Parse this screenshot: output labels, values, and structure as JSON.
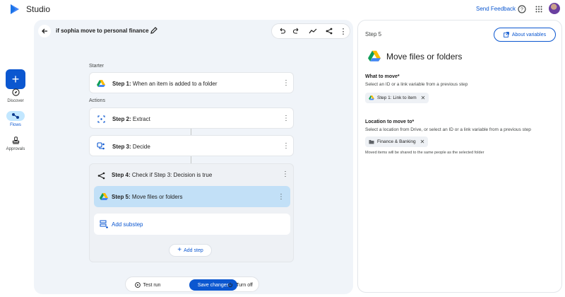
{
  "app": {
    "title": "Studio",
    "logo_icon": "studio-logo-icon"
  },
  "topbar": {
    "send_feedback": "Send Feedback",
    "help_icon": "help-icon",
    "apps_icon": "apps-grid-icon",
    "avatar_icon": "user-avatar"
  },
  "rail": {
    "new_icon": "plus-icon",
    "items": [
      {
        "label": "Discover",
        "icon": "compass-icon"
      },
      {
        "label": "Flows",
        "icon": "flows-icon",
        "active": true
      },
      {
        "label": "Approvals",
        "icon": "approvals-icon"
      }
    ]
  },
  "flow": {
    "title": "if sophia move to personal finance",
    "toolbar": [
      "undo-icon",
      "redo-icon",
      "activity-icon",
      "share-icon",
      "more-vert-icon"
    ]
  },
  "sections": {
    "starter": "Starter",
    "actions": "Actions"
  },
  "steps": [
    {
      "num": "Step 1:",
      "text": " When an item is added to a folder",
      "icon": "drive-icon"
    },
    {
      "num": "Step 2:",
      "text": " Extract",
      "icon": "extract-icon"
    },
    {
      "num": "Step 3:",
      "text": " Decide",
      "icon": "decide-icon"
    },
    {
      "num": "Step 4:",
      "text": " Check if Step 3: Decision is true",
      "icon": "branch-icon"
    },
    {
      "num": "Step 5:",
      "text": " Move files or folders",
      "icon": "drive-icon"
    }
  ],
  "add_substep": "Add substep",
  "add_step": "Add step",
  "bottom_bar": {
    "test_run": "Test run",
    "save_changes": "Save changes",
    "turn_off": "Turn off"
  },
  "panel": {
    "step_label": "Step 5",
    "about_variables": "About variables",
    "title": "Move files or folders",
    "what_label": "What to move*",
    "what_help": "Select an ID or a link variable from a previous step",
    "what_chip": "Step 1: Link to item",
    "location_label": "Location to move to*",
    "location_help": "Select a location from Drive, or select an ID or a link variable from a previous step",
    "location_chip": "Finance & Banking",
    "location_note": "Moved items will be shared to the same people as the selected folder"
  },
  "colors": {
    "accent": "#0b57d0",
    "selected": "#c2e0f7",
    "canvas": "#f0f4f9"
  }
}
